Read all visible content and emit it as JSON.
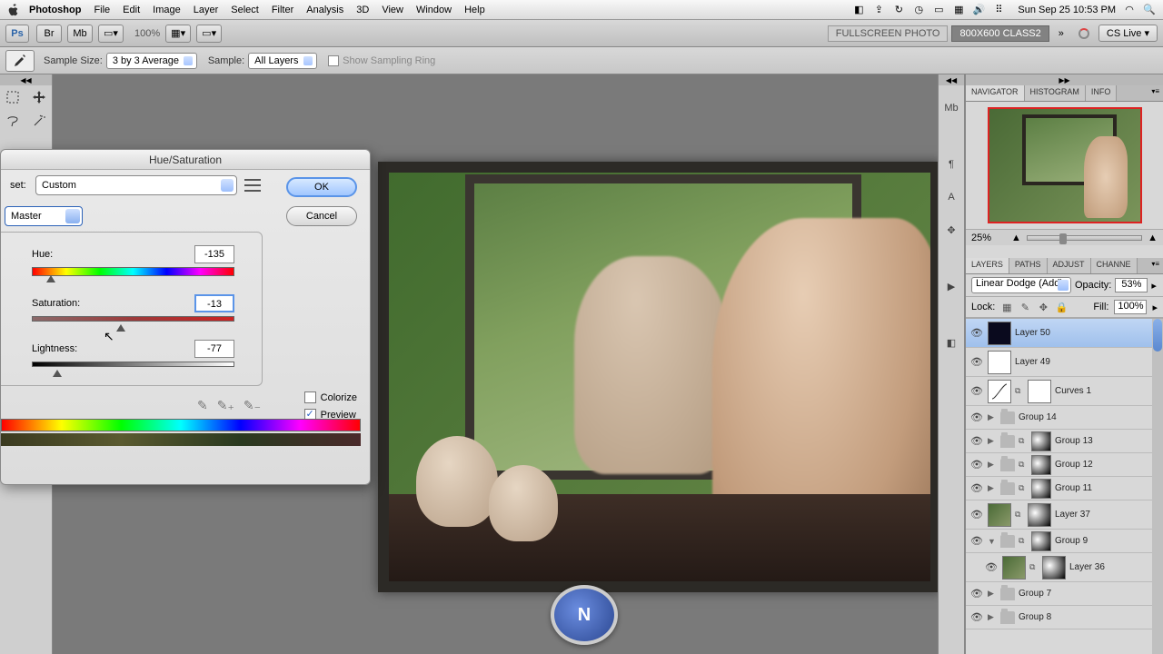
{
  "menubar": {
    "app": "Photoshop",
    "items": [
      "File",
      "Edit",
      "Image",
      "Layer",
      "Select",
      "Filter",
      "Analysis",
      "3D",
      "View",
      "Window",
      "Help"
    ],
    "clock": "Sun Sep 25  10:53 PM"
  },
  "appbar": {
    "logo": "Ps",
    "zoom": "100%",
    "doc_tabs": [
      "FULLSCREEN PHOTO",
      "800X600 CLASS2"
    ],
    "active_tab": 1,
    "cs_live": "CS Live"
  },
  "options": {
    "sample_size_label": "Sample Size:",
    "sample_size_value": "3 by 3 Average",
    "sample_label": "Sample:",
    "sample_value": "All Layers",
    "show_ring": "Show Sampling Ring"
  },
  "dialog": {
    "title": "Hue/Saturation",
    "preset_label": "set:",
    "preset_value": "Custom",
    "channel": "Master",
    "hue_label": "Hue:",
    "hue_value": "-135",
    "sat_label": "Saturation:",
    "sat_value": "-13",
    "light_label": "Lightness:",
    "light_value": "-77",
    "ok": "OK",
    "cancel": "Cancel",
    "colorize": "Colorize",
    "preview": "Preview"
  },
  "navigator": {
    "tabs": [
      "NAVIGATOR",
      "HISTOGRAM",
      "INFO"
    ],
    "zoom": "25%"
  },
  "layers_panel": {
    "tabs": [
      "LAYERS",
      "PATHS",
      "ADJUST",
      "CHANNE"
    ],
    "blend_mode": "Linear Dodge (Add)",
    "opacity_label": "Opacity:",
    "opacity": "53%",
    "lock_label": "Lock:",
    "fill_label": "Fill:",
    "fill": "100%",
    "layers": [
      {
        "name": "Layer 50",
        "type": "layer",
        "selected": true,
        "thumb": "dark"
      },
      {
        "name": "Layer 49",
        "type": "layer",
        "thumb": "white"
      },
      {
        "name": "Curves 1",
        "type": "adj",
        "thumb": "curves"
      },
      {
        "name": "Group 14",
        "type": "group"
      },
      {
        "name": "Group 13",
        "type": "group",
        "mask": true
      },
      {
        "name": "Group 12",
        "type": "group",
        "mask": true
      },
      {
        "name": "Group 11",
        "type": "group",
        "mask": true
      },
      {
        "name": "Layer 37",
        "type": "layer",
        "thumb": "img",
        "mask": true
      },
      {
        "name": "Group 9",
        "type": "group",
        "open": true,
        "mask": true
      },
      {
        "name": "Layer 36",
        "type": "layer",
        "thumb": "img",
        "mask": true,
        "child": true
      },
      {
        "name": "Group 7",
        "type": "group"
      },
      {
        "name": "Group 8",
        "type": "group"
      }
    ]
  },
  "watermark": "N"
}
